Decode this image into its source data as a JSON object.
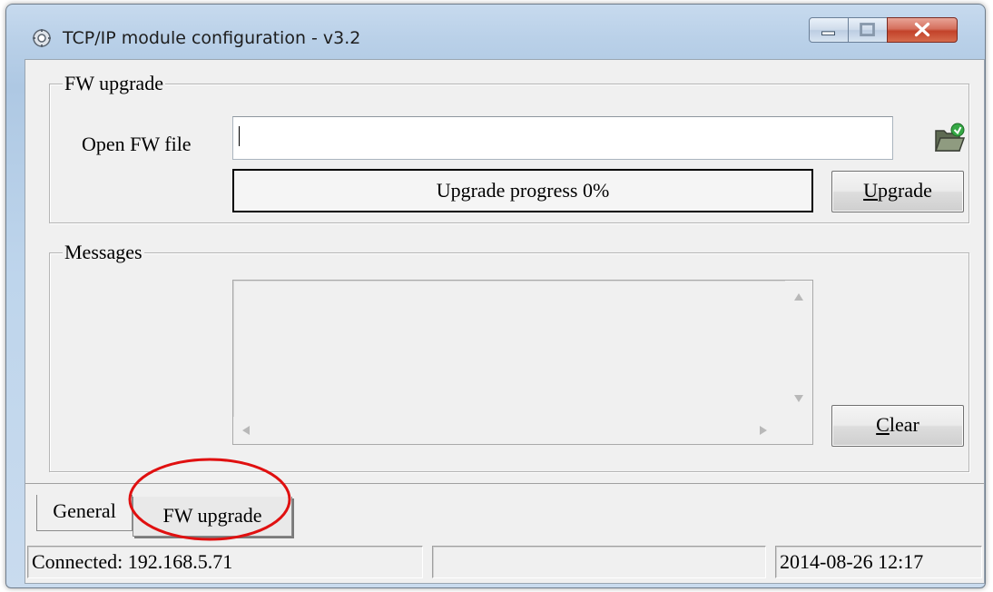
{
  "window": {
    "title": "TCP/IP module configuration - v3.2",
    "icon": "gear-icon"
  },
  "fw_group": {
    "legend": "FW upgrade",
    "open_file_label": "Open FW file",
    "file_path_value": "",
    "browse_icon": "open-folder-icon",
    "progress_text": "Upgrade progress 0%",
    "progress_value": 0,
    "upgrade_button": {
      "accel": "U",
      "rest": "pgrade"
    }
  },
  "messages_group": {
    "legend": "Messages",
    "clear_button": {
      "accel": "C",
      "rest": "lear"
    }
  },
  "tabs": [
    {
      "label": "General",
      "active": false
    },
    {
      "label": "FW upgrade",
      "active": true
    }
  ],
  "status_bar": {
    "connection": "Connected: 192.168.5.71",
    "middle": "",
    "datetime": "2014-08-26 12:17"
  },
  "colors": {
    "annotation_ellipse": "#e01010",
    "close_button": "#c2422a"
  }
}
